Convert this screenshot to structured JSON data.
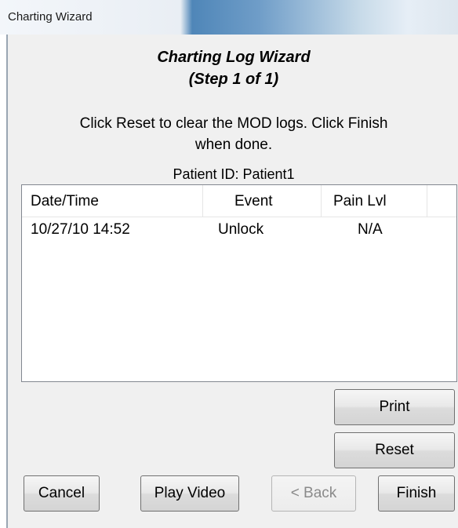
{
  "window": {
    "title": "Charting Wizard"
  },
  "wizard": {
    "heading_line1": "Charting Log Wizard",
    "heading_line2": "(Step 1 of 1)",
    "instruction_line1": "Click Reset to clear the MOD logs. Click Finish",
    "instruction_line2": "when done.",
    "patient_id": "Patient ID: Patient1"
  },
  "log_table": {
    "columns": [
      "Date/Time",
      "Event",
      "Pain Lvl"
    ],
    "rows": [
      {
        "datetime": "10/27/10 14:52",
        "event": "Unlock",
        "pain_level": "N/A"
      }
    ]
  },
  "buttons": {
    "print": "Print",
    "reset": "Reset",
    "cancel": "Cancel",
    "play_video": "Play Video",
    "back": "< Back",
    "finish": "Finish"
  }
}
